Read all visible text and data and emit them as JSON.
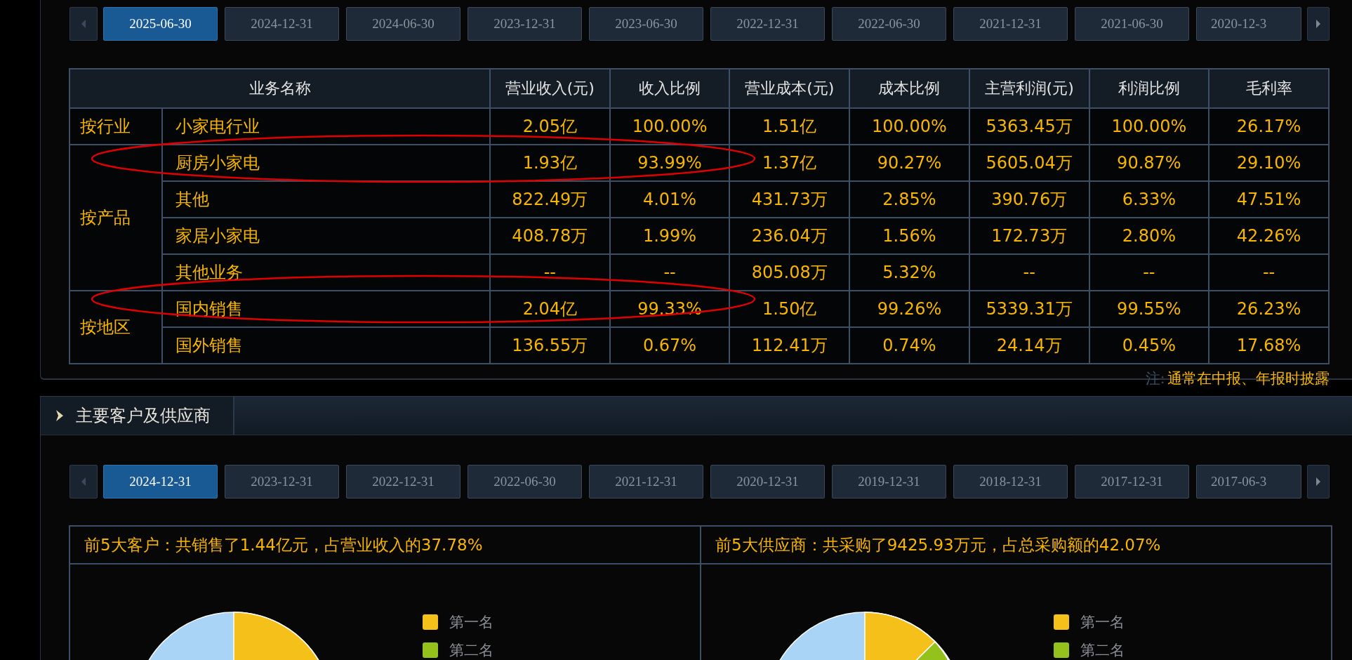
{
  "business_panel": {
    "date_tabs": [
      {
        "label": "2025-06-30",
        "selected": true
      },
      {
        "label": "2024-12-31",
        "selected": false
      },
      {
        "label": "2024-06-30",
        "selected": false
      },
      {
        "label": "2023-12-31",
        "selected": false
      },
      {
        "label": "2023-06-30",
        "selected": false
      },
      {
        "label": "2022-12-31",
        "selected": false
      },
      {
        "label": "2022-06-30",
        "selected": false
      },
      {
        "label": "2021-12-31",
        "selected": false
      },
      {
        "label": "2021-06-30",
        "selected": false
      },
      {
        "label": "2020-12-3",
        "selected": false
      }
    ],
    "table": {
      "columns": [
        "业务名称",
        "营业收入(元)",
        "收入比例",
        "营业成本(元)",
        "成本比例",
        "主营利润(元)",
        "利润比例",
        "毛利率"
      ],
      "groups": [
        {
          "label": "按行业",
          "rows": [
            {
              "name": "小家电行业",
              "circled": false,
              "values": [
                "2.05亿",
                "100.00%",
                "1.51亿",
                "100.00%",
                "5363.45万",
                "100.00%",
                "26.17%"
              ]
            }
          ]
        },
        {
          "label": "按产品",
          "rows": [
            {
              "name": "厨房小家电",
              "circled": true,
              "values": [
                "1.93亿",
                "93.99%",
                "1.37亿",
                "90.27%",
                "5605.04万",
                "90.87%",
                "29.10%"
              ]
            },
            {
              "name": "其他",
              "circled": false,
              "values": [
                "822.49万",
                "4.01%",
                "431.73万",
                "2.85%",
                "390.76万",
                "6.33%",
                "47.51%"
              ]
            },
            {
              "name": "家居小家电",
              "circled": false,
              "values": [
                "408.78万",
                "1.99%",
                "236.04万",
                "1.56%",
                "172.73万",
                "2.80%",
                "42.26%"
              ]
            },
            {
              "name": "其他业务",
              "circled": false,
              "values": [
                "--",
                "--",
                "805.08万",
                "5.32%",
                "--",
                "--",
                "--"
              ]
            }
          ]
        },
        {
          "label": "按地区",
          "rows": [
            {
              "name": "国内销售",
              "circled": true,
              "values": [
                "2.04亿",
                "99.33%",
                "1.50亿",
                "99.26%",
                "5339.31万",
                "99.55%",
                "26.23%"
              ]
            },
            {
              "name": "国外销售",
              "circled": false,
              "values": [
                "136.55万",
                "0.67%",
                "112.41万",
                "0.74%",
                "24.14万",
                "0.45%",
                "17.68%"
              ]
            }
          ]
        }
      ]
    },
    "note": {
      "label": "注:",
      "text": "通常在中报、年报时披露"
    }
  },
  "customers_panel": {
    "title": "主要客户及供应商",
    "date_tabs": [
      {
        "label": "2024-12-31",
        "selected": true
      },
      {
        "label": "2023-12-31",
        "selected": false
      },
      {
        "label": "2022-12-31",
        "selected": false
      },
      {
        "label": "2022-06-30",
        "selected": false
      },
      {
        "label": "2021-12-31",
        "selected": false
      },
      {
        "label": "2020-12-31",
        "selected": false
      },
      {
        "label": "2019-12-31",
        "selected": false
      },
      {
        "label": "2018-12-31",
        "selected": false
      },
      {
        "label": "2017-12-31",
        "selected": false
      },
      {
        "label": "2017-06-3",
        "selected": false
      }
    ],
    "boxes": [
      {
        "title": "前5大客户：共销售了1.44亿元，占营业收入的37.78%",
        "legend": [
          {
            "label": "第一名",
            "color": "#f5c01a"
          },
          {
            "label": "第二名",
            "color": "#94c11c"
          }
        ]
      },
      {
        "title": "前5大供应商：共采购了9425.93万元，占总采购额的42.07%",
        "legend": [
          {
            "label": "第一名",
            "color": "#f5c01a"
          },
          {
            "label": "第二名",
            "color": "#94c11c"
          }
        ]
      }
    ]
  }
}
